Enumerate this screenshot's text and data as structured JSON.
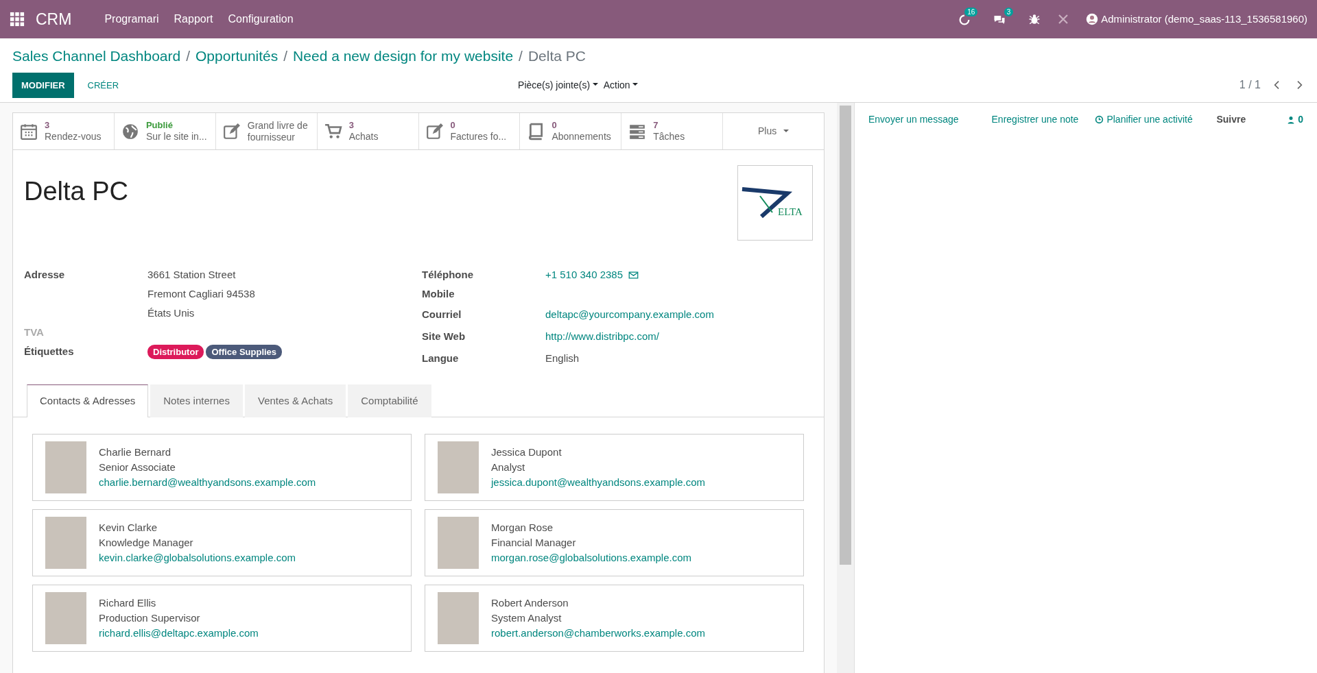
{
  "navbar": {
    "app_name": "CRM",
    "menu": [
      "Programari",
      "Rapport",
      "Configuration"
    ],
    "activity_count": "16",
    "message_count": "3",
    "user": "Administrator (demo_saas-113_1536581960)"
  },
  "breadcrumb": [
    {
      "text": "Sales Channel Dashboard",
      "separator": "/"
    },
    {
      "text": "Opportunités",
      "separator": "/"
    },
    {
      "text": "Need a new design for my website",
      "separator": "/"
    },
    {
      "text": "Delta PC"
    }
  ],
  "buttons": {
    "edit": "MODIFIER",
    "create": "CRÉER"
  },
  "sidebar_menus": [
    "Pièce(s) jointe(s)",
    "Action"
  ],
  "pager": "1 / 1",
  "stat_buttons": [
    {
      "kind": "count",
      "value": "3",
      "label": "Rendez-vous"
    },
    {
      "kind": "published",
      "value": "Publié",
      "label": "Sur le site in..."
    },
    {
      "kind": "text",
      "value": "Grand livre de",
      "label": "fournisseur"
    },
    {
      "kind": "count",
      "value": "3",
      "label": "Achats"
    },
    {
      "kind": "count",
      "value": "0",
      "label": "Factures fo..."
    },
    {
      "kind": "count",
      "value": "0",
      "label": "Abonnements"
    },
    {
      "kind": "count",
      "value": "7",
      "label": "Tâches"
    },
    {
      "kind": "more",
      "label": "Plus"
    }
  ],
  "partner": {
    "name": "Delta PC",
    "logo_text": "ELTA"
  },
  "left_fields": [
    {
      "label": "Adresse",
      "lines": [
        "3661 Station Street",
        "Fremont  Cagliari  94538",
        "États Unis"
      ],
      "disabled": false
    },
    {
      "label": "TVA",
      "disabled": true
    },
    {
      "label": "Étiquettes",
      "tags": [
        {
          "text": "Distributor",
          "color": "#dc1a5a"
        },
        {
          "text": "Office Supplies",
          "color": "#4c5a7a"
        }
      ],
      "disabled": false
    }
  ],
  "right_fields": [
    {
      "label": "Téléphone",
      "value": "+1 510 340 2385",
      "kind": "phone"
    },
    {
      "label": "Mobile",
      "kind": "empty"
    },
    {
      "label": "Courriel",
      "value": "deltapc@yourcompany.example.com",
      "kind": "link"
    },
    {
      "label": "Site Web",
      "value": "http://www.distribpc.com/",
      "kind": "link"
    },
    {
      "label": "Langue",
      "value": "English",
      "kind": "plain"
    }
  ],
  "tabs": [
    {
      "label": "Contacts & Adresses",
      "selected": true
    },
    {
      "label": "Notes internes",
      "selected": false
    },
    {
      "label": "Ventes & Achats",
      "selected": false
    },
    {
      "label": "Comptabilité",
      "selected": false
    }
  ],
  "contacts": [
    {
      "name": "Charlie Bernard",
      "function": "Senior Associate",
      "email": "charlie.bernard@wealthyandsons.example.com"
    },
    {
      "name": "Jessica Dupont",
      "function": "Analyst",
      "email": "jessica.dupont@wealthyandsons.example.com"
    },
    {
      "name": "Kevin Clarke",
      "function": "Knowledge Manager",
      "email": "kevin.clarke@globalsolutions.example.com"
    },
    {
      "name": "Morgan Rose",
      "function": "Financial Manager",
      "email": "morgan.rose@globalsolutions.example.com"
    },
    {
      "name": "Richard Ellis",
      "function": "Production Supervisor",
      "email": "richard.ellis@deltapc.example.com"
    },
    {
      "name": "Robert Anderson",
      "function": "System Analyst",
      "email": "robert.anderson@chamberworks.example.com"
    }
  ],
  "chatter": {
    "send_message": "Envoyer un message",
    "log_note": "Enregistrer une note",
    "schedule_activity": "Planifier une activité",
    "follow": "Suivre",
    "followers": "0"
  }
}
